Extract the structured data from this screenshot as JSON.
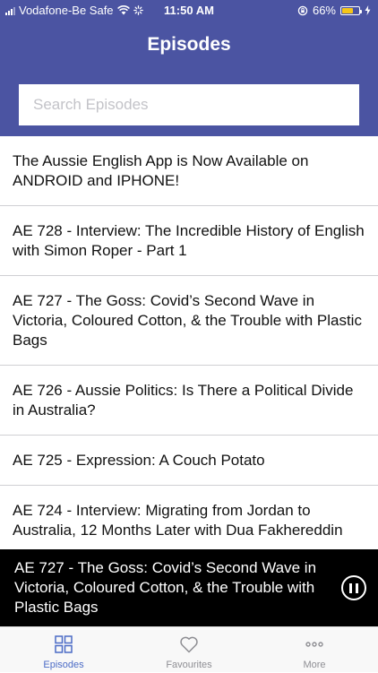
{
  "status_bar": {
    "carrier": "Vodafone-Be Safe",
    "time": "11:50 AM",
    "battery": "66%",
    "battery_level": 0.66,
    "battery_color": "#f5c518"
  },
  "header": {
    "title": "Episodes",
    "background": "#4b54a2"
  },
  "search": {
    "placeholder": "Search Episodes",
    "value": ""
  },
  "episodes": [
    "The Aussie English App is Now Available on ANDROID and IPHONE!",
    "AE 728 - Interview: The Incredible History of English with Simon Roper - Part 1",
    "AE 727 - The Goss: Covid’s Second Wave in Victoria, Coloured Cotton, & the Trouble with Plastic Bags",
    "AE 726 - Aussie Politics: Is There a Political Divide in Australia?",
    "AE 725 - Expression: A Couch Potato",
    "AE 724 - Interview: Migrating from Jordan to Australia, 12 Months Later with Dua Fakhereddin"
  ],
  "player": {
    "title": "AE 727 - The Goss: Covid’s Second Wave in Victoria, Coloured Cotton, & the Trouble with Plastic Bags",
    "control_icon": "pause-icon"
  },
  "tabs": [
    {
      "label": "Episodes",
      "icon": "grid-icon",
      "active": true
    },
    {
      "label": "Favourites",
      "icon": "heart-icon",
      "active": false
    },
    {
      "label": "More",
      "icon": "more-icon",
      "active": false
    }
  ],
  "colors": {
    "tab_active": "#4b6bc6",
    "tab_inactive": "#8e8e93"
  }
}
